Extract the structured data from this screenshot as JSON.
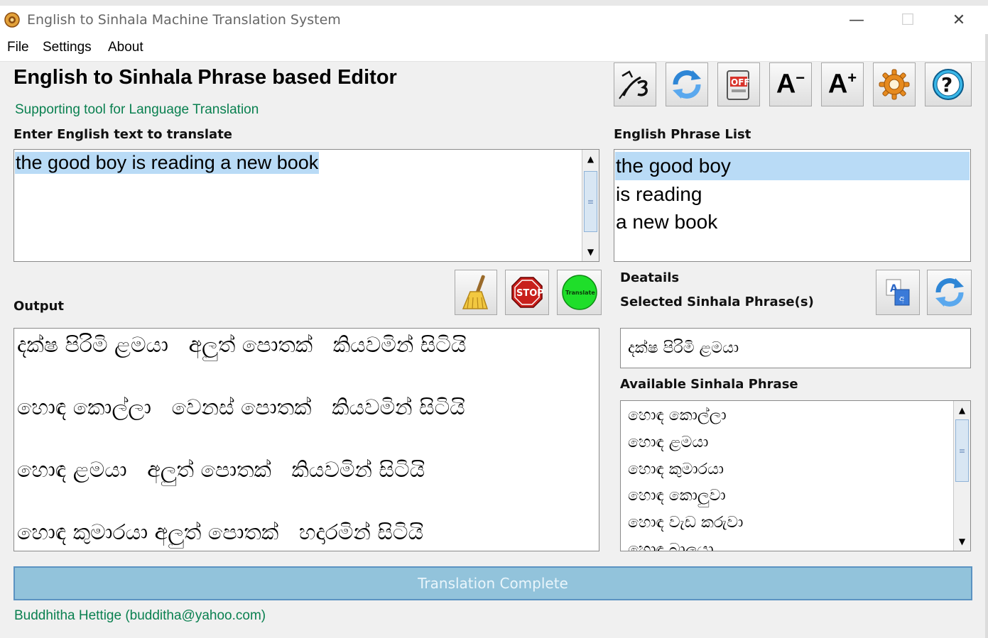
{
  "window": {
    "title": "English to Sinhala Machine Translation System",
    "minimize": "—",
    "maximize": "☐",
    "close": "✕"
  },
  "menu": [
    "File",
    "Settings",
    "About"
  ],
  "header": {
    "title": "English to Sinhala Phrase based Editor",
    "subtitle": "Supporting tool for Language Translation"
  },
  "toolbar": {
    "icons": [
      "pen-logo-icon",
      "refresh-icon",
      "power-off-icon",
      "font-decrease-icon",
      "font-increase-icon",
      "settings-gear-icon",
      "help-icon"
    ],
    "off_text": "OFF",
    "font_dec": "A",
    "font_dec_sup": "−",
    "font_inc": "A",
    "font_inc_sup": "+",
    "help": "?"
  },
  "input": {
    "label": "Enter English text to translate",
    "value": "the good boy is reading a new book"
  },
  "phrase_list": {
    "label": "English Phrase List",
    "items": [
      "the good boy",
      "is reading",
      "a new book"
    ],
    "selected_index": 0
  },
  "actions": {
    "clear_icon": "broom-icon",
    "stop_label": "STOP",
    "translate_label": "Translate"
  },
  "output": {
    "label": "Output",
    "lines": [
      "දක්ෂ පිරිමි ළමයා   අලුත් පොතක්   කියවමින් සිටියි",
      "හොඳ කොල්ලා   වෙනස් පොතක්   කියවමින් සිටියි",
      "හොඳ ළමයා   අලුත් පොතක්   කියවමින් සිටියි",
      "හොඳ කුමාරයා අලුත් පොතක්   හදාරමින් සිටියි"
    ]
  },
  "details": {
    "label": "Deatails",
    "selected_label": "Selected Sinhala Phrase(s)",
    "selected_value": "දක්ෂ පිරිමි ළමයා",
    "available_label": "Available Sinhala Phrase",
    "available_items": [
      "හොඳ කොල්ලා",
      "හොඳ ළමයා",
      "හොඳ කුමාරයා",
      "හොඳ කොලුවා",
      "හොඳ වැඩ කරුවා",
      "හොඳ බාලයා"
    ]
  },
  "status": {
    "text": "Translation Complete",
    "bar_color": "#92c3db"
  },
  "footer": {
    "author": "Buddhitha Hettige (budditha@yahoo.com)"
  },
  "colors": {
    "accent_green": "#0a8050",
    "selection": "#b9dbf6"
  }
}
